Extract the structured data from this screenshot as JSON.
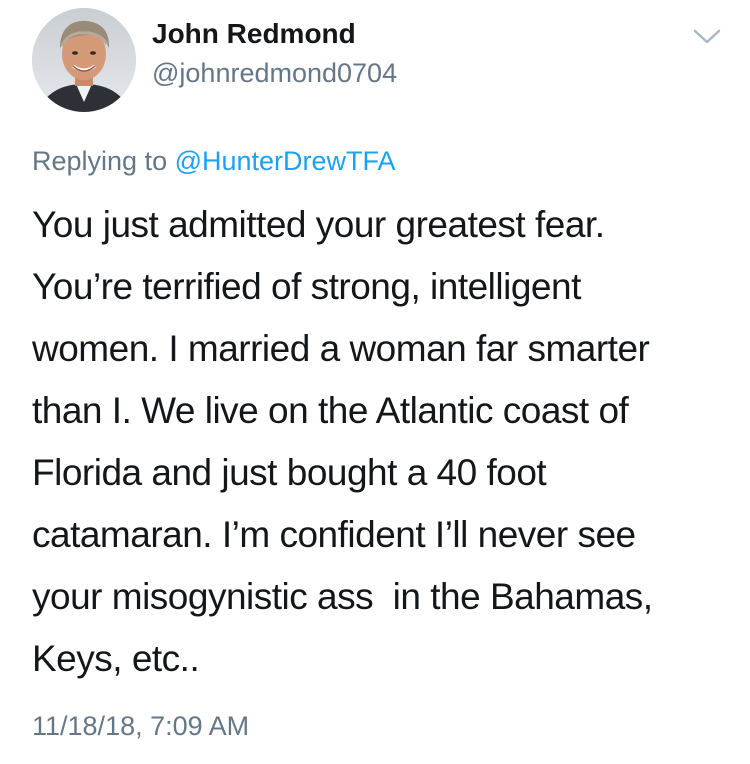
{
  "author": {
    "display_name": "John Redmond",
    "handle": "@johnredmond0704"
  },
  "reply": {
    "prefix": "Replying to ",
    "mention": "@HunterDrewTFA"
  },
  "tweet": {
    "lines": [
      "You just admitted your greatest fear.",
      "You’re terrified of strong, intelligent",
      "women. I married a woman far smarter",
      "than I. We live on the Atlantic coast of",
      "Florida and just bought a 40 foot",
      "catamaran. I’m confident I’ll never see",
      "your misogynistic ass  in the Bahamas,",
      "Keys, etc.."
    ],
    "timestamp": "11/18/18, 7:09 AM"
  },
  "icons": {
    "menu": "chevron-down-icon",
    "avatar": "avatar-photo"
  },
  "colors": {
    "text": "#14171a",
    "secondary": "#657786",
    "link": "#1da1f2"
  }
}
